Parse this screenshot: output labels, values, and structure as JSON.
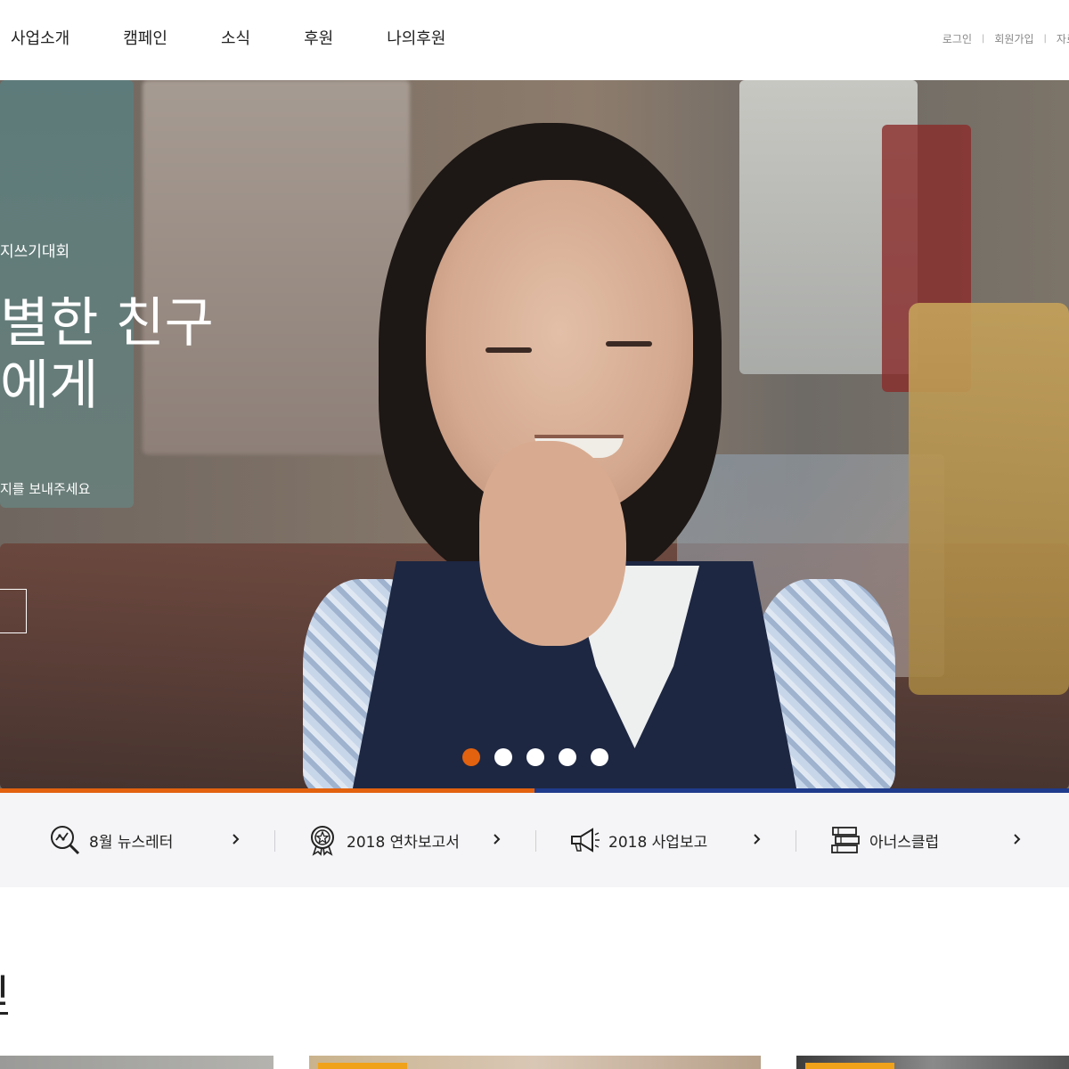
{
  "header": {
    "nav": [
      "사업소개",
      "캠페인",
      "소식",
      "후원",
      "나의후원"
    ],
    "util": {
      "login": "로그인",
      "signup": "회원가입",
      "resources": "자료"
    }
  },
  "hero": {
    "subtitle": "지쓰기대회",
    "title_line1": "별한 친구",
    "title_line2": "에게",
    "description": "지를 보내주세요",
    "slides_total": 5,
    "active_slide": 1
  },
  "progress": {
    "fraction": 0.5,
    "colors": {
      "done": "#e2620f",
      "remaining": "#1f3b8c"
    }
  },
  "quick_links": [
    {
      "label": "8월 뉴스레터",
      "icon": "magnifier-chart-icon"
    },
    {
      "label": "2018 연차보고서",
      "icon": "award-badge-icon"
    },
    {
      "label": "2018 사업보고",
      "icon": "megaphone-icon"
    },
    {
      "label": "아너스클럽",
      "icon": "books-icon"
    }
  ],
  "section": {
    "title": "인"
  },
  "colors": {
    "accent": "#e2620f",
    "brand_blue": "#1f3b8c"
  }
}
